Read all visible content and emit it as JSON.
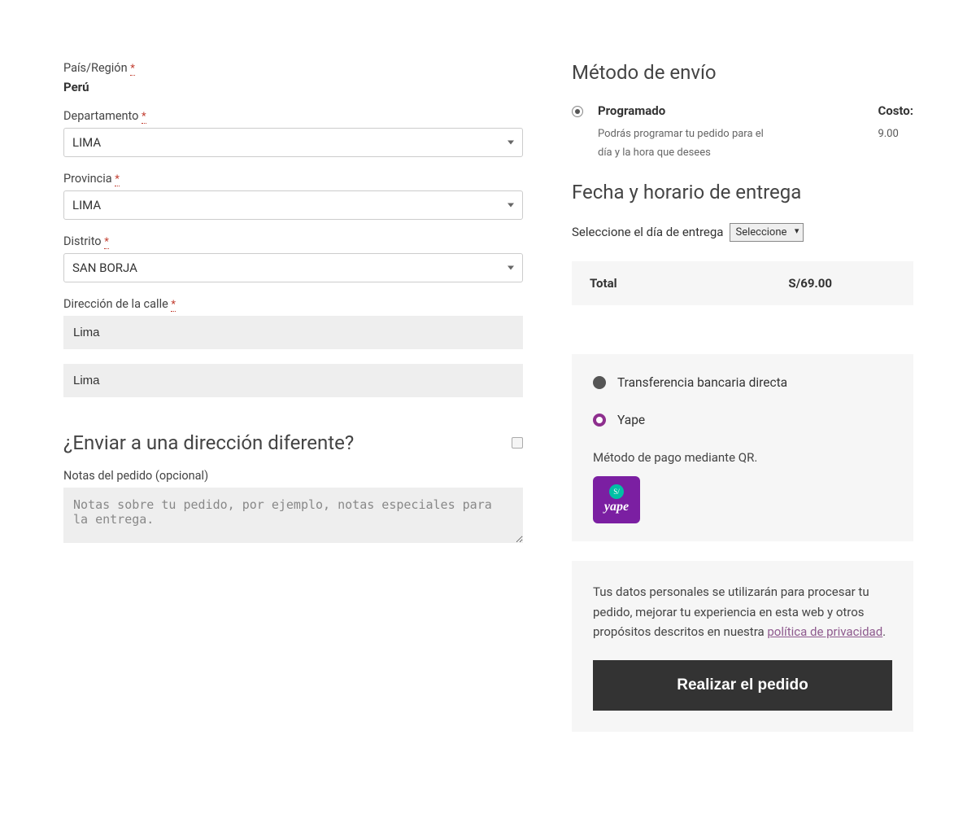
{
  "billing": {
    "country_label": "País/Región",
    "country_value": "Perú",
    "department_label": "Departamento",
    "department_value": "LIMA",
    "province_label": "Provincia",
    "province_value": "LIMA",
    "district_label": "Distrito",
    "district_value": "SAN BORJA",
    "street_label": "Dirección de la calle",
    "street_value1": "Lima",
    "street_value2": "Lima"
  },
  "ship_diff": {
    "heading": "¿Enviar a una dirección diferente?",
    "notes_label": "Notas del pedido (opcional)",
    "notes_placeholder": "Notas sobre tu pedido, por ejemplo, notas especiales para la entrega."
  },
  "shipping": {
    "heading": "Método de envío",
    "option_name": "Programado",
    "option_desc": "Podrás programar tu pedido para el día y la hora que desees",
    "cost_label": "Costo:",
    "cost_value": "9.00"
  },
  "delivery": {
    "heading": "Fecha y horario de entrega",
    "day_label": "Seleccione el día de entrega",
    "day_value": "Seleccione"
  },
  "total": {
    "label": "Total",
    "value": "S/69.00"
  },
  "payment": {
    "option1": "Transferencia bancaria directa",
    "option2": "Yape",
    "yape_desc": "Método de pago mediante QR.",
    "yape_logo_coin": "S/",
    "yape_logo_text": "yape"
  },
  "privacy": {
    "text_before": "Tus datos personales se utilizarán para procesar tu pedido, mejorar tu experiencia en esta web y otros propósitos descritos en nuestra ",
    "link_text": "política de privacidad",
    "text_after": "."
  },
  "submit": {
    "label": "Realizar el pedido"
  }
}
